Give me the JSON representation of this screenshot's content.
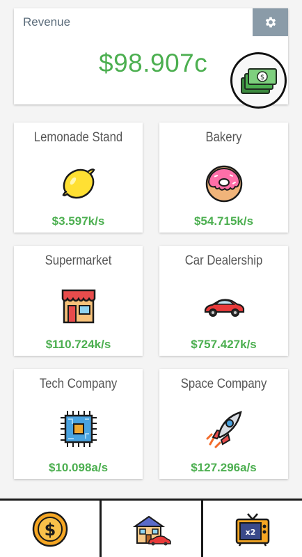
{
  "revenue": {
    "label": "Revenue",
    "value": "$98.907c",
    "settings_icon": "gear-icon",
    "collect_icon": "cash-stack-icon"
  },
  "businesses": [
    {
      "name": "Lemonade Stand",
      "rate": "$3.597k/s",
      "icon": "lemon-icon"
    },
    {
      "name": "Bakery",
      "rate": "$54.715k/s",
      "icon": "donut-icon"
    },
    {
      "name": "Supermarket",
      "rate": "$110.724k/s",
      "icon": "store-icon"
    },
    {
      "name": "Car Dealership",
      "rate": "$757.427k/s",
      "icon": "car-icon"
    },
    {
      "name": "Tech Company",
      "rate": "$10.098a/s",
      "icon": "microchip-icon"
    },
    {
      "name": "Space Company",
      "rate": "$127.296a/s",
      "icon": "rocket-icon"
    }
  ],
  "bottom_nav": [
    {
      "icon": "dollar-coin-icon"
    },
    {
      "icon": "house-car-icon"
    },
    {
      "icon": "tv-x2-icon",
      "badge": "x2"
    }
  ],
  "colors": {
    "accent_green": "#4caf50",
    "settings_bg": "#8a9ba8"
  }
}
